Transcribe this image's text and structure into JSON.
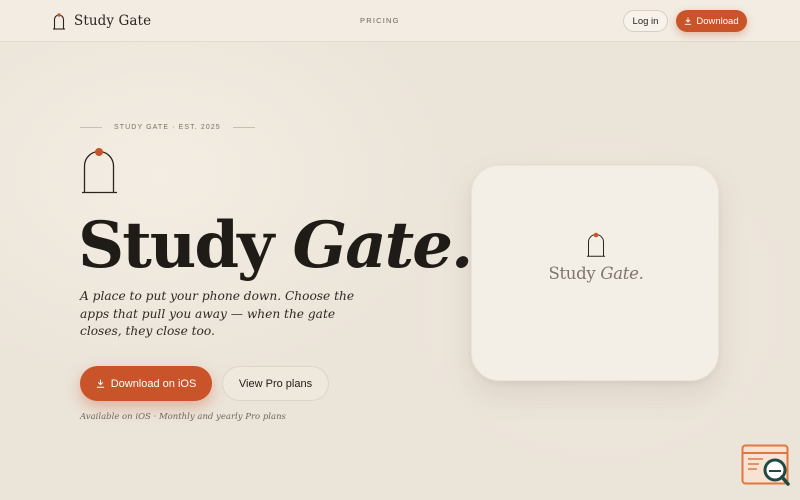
{
  "nav": {
    "brand": "Study Gate",
    "links": [
      {
        "label": "PRICING"
      }
    ],
    "login_label": "Log in",
    "download_label": "Download"
  },
  "hero": {
    "eyebrow": "STUDY GATE · EST. 2025",
    "title_plain": "Study",
    "title_italic": "Gate.",
    "subtitle": "A place to put your phone down. Choose the apps that pull you away — when the gate closes, they close too.",
    "primary_cta": "Download on iOS",
    "secondary_cta": "View Pro plans",
    "availability": "Available on iOS · Monthly and yearly Pro plans"
  },
  "card": {
    "name_plain": "Study",
    "name_italic": "Gate."
  },
  "icons": {
    "brand": "gate-arch-icon",
    "download": "download-icon",
    "widget": "search-document-icon"
  },
  "colors": {
    "accent": "#c9542a",
    "background": "#ebe4d9",
    "nav_background": "#f2ece2",
    "card_background": "#f4efe6",
    "text": "#1f1b17"
  }
}
